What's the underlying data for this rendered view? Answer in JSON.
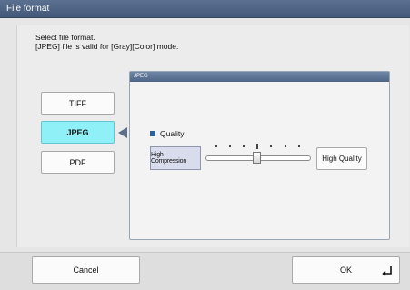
{
  "window": {
    "title": "File format"
  },
  "instructions": {
    "line1": "Select file format.",
    "line2": "[JPEG] file is valid for [Gray][Color] mode."
  },
  "formats": [
    {
      "label": "TIFF",
      "selected": false
    },
    {
      "label": "JPEG",
      "selected": true
    },
    {
      "label": "PDF",
      "selected": false
    }
  ],
  "panel": {
    "header": "JPEG",
    "quality_label": "Quality",
    "min_label": "High Compression",
    "max_label": "High Quality",
    "slider_level_fraction": 0.5
  },
  "footer": {
    "cancel_label": "Cancel",
    "ok_label": "OK"
  },
  "icons": {
    "ok": "enter-icon",
    "selection": "arrow-left-icon"
  },
  "colors": {
    "titlebar": "#4c6283",
    "selected_button": "#8ff0f8",
    "quality_marker": "#2f5ea0"
  }
}
